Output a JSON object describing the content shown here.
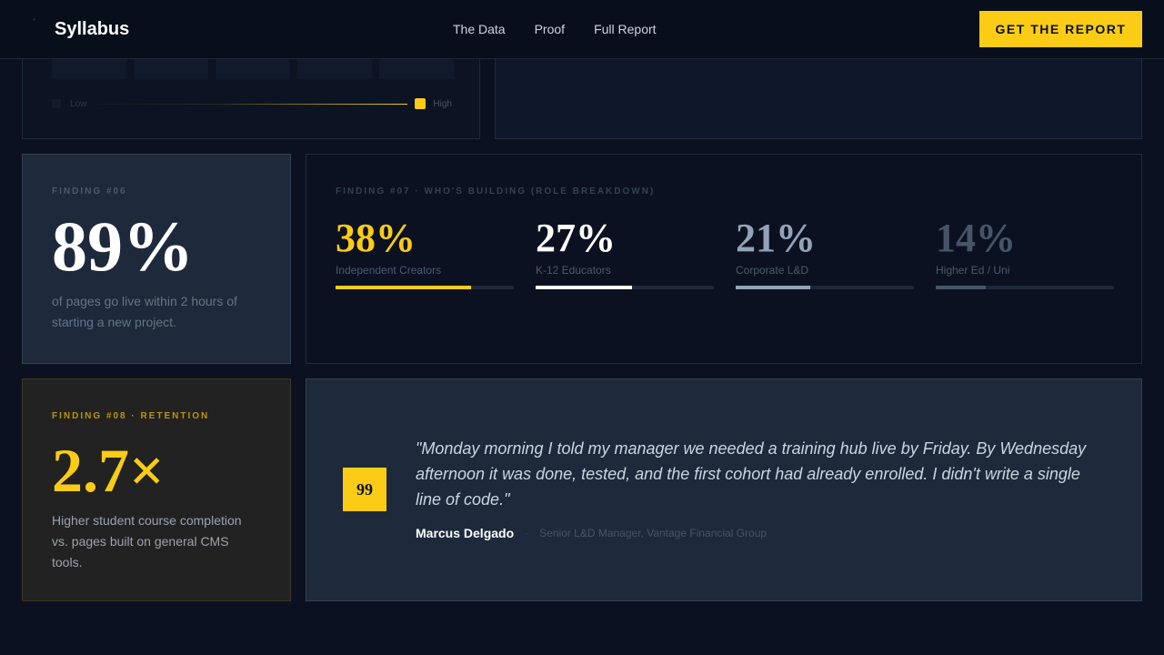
{
  "header": {
    "brand": "Syllabus",
    "nav": [
      "The Data",
      "Proof",
      "Full Report"
    ],
    "cta": "GET THE REPORT"
  },
  "scale": {
    "low": "Low",
    "high": "High"
  },
  "finding06": {
    "eyebrow": "FINDING #06",
    "value": "89%",
    "description": "of pages go live within 2 hours of starting a new project."
  },
  "finding07": {
    "eyebrow": "FINDING #07 · WHO'S BUILDING (ROLE BREAKDOWN)",
    "stats": [
      {
        "value": "38%",
        "label": "Independent Creators",
        "level": 76,
        "color": "#facc15"
      },
      {
        "value": "27%",
        "label": "K-12 Educators",
        "level": 54,
        "color": "#ffffff"
      },
      {
        "value": "21%",
        "label": "Corporate L&D",
        "level": 42,
        "color": "#94a3b8"
      },
      {
        "value": "14%",
        "label": "Higher Ed / Uni",
        "level": 28,
        "color": "#475569"
      }
    ]
  },
  "finding08": {
    "eyebrow": "FINDING #08 · RETENTION",
    "value": "2.7×",
    "description": "Higher student course completion vs. pages built on general CMS tools."
  },
  "testimonial": {
    "badge": "99",
    "quote": "\"Monday morning I told my manager we needed a training hub live by Friday. By Wednesday afternoon it was done, tested, and the first cohort had already enrolled. I didn't write a single line of code.\"",
    "author": "Marcus Delgado",
    "separator": "·",
    "role": "Senior L&D Manager, Vantage Financial Group"
  },
  "colors": {
    "accent": "#facc15",
    "background": "#0b1120",
    "card": "#1e293b"
  }
}
